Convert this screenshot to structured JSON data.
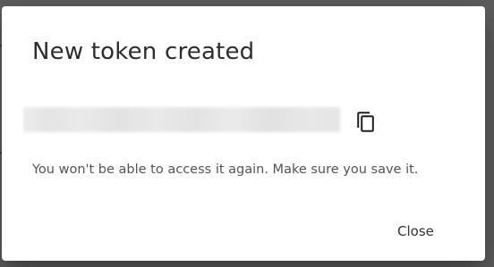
{
  "dialog": {
    "title": "New token created",
    "token_value": "",
    "copy_icon": "copy-icon",
    "message": "You won't be able to access it again. Make sure you save it.",
    "close_label": "Close"
  },
  "colors": {
    "backdrop": "#5e5e5e",
    "dialog_background": "#ffffff",
    "title_text": "#2d2d2d",
    "body_text": "#545454",
    "redacted_token": "#e6e6e6"
  }
}
